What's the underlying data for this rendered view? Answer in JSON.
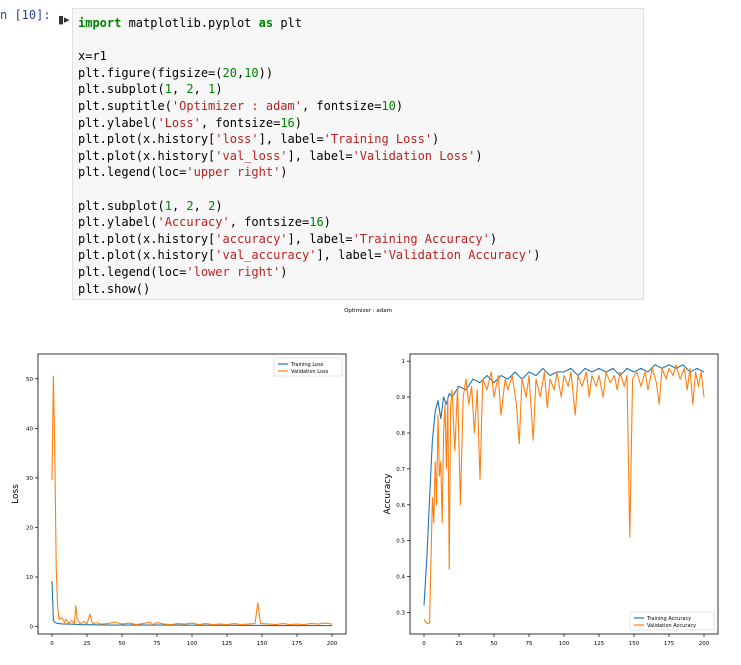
{
  "cell": {
    "prompt": "n [10]:",
    "code_lines": [
      [
        [
          "kw",
          "import"
        ],
        [
          "t",
          " matplotlib.pyplot "
        ],
        [
          "kw",
          "as"
        ],
        [
          "t",
          " plt"
        ]
      ],
      [],
      [
        [
          "t",
          "x=r1"
        ]
      ],
      [
        [
          "t",
          "plt.figure(figsize=("
        ],
        [
          "num",
          "20"
        ],
        [
          "t",
          ","
        ],
        [
          "num",
          "10"
        ],
        [
          "t",
          "))"
        ]
      ],
      [
        [
          "t",
          "plt.subplot("
        ],
        [
          "num",
          "1"
        ],
        [
          "t",
          ", "
        ],
        [
          "num",
          "2"
        ],
        [
          "t",
          ", "
        ],
        [
          "num",
          "1"
        ],
        [
          "t",
          ")"
        ]
      ],
      [
        [
          "t",
          "plt.suptitle("
        ],
        [
          "str",
          "'Optimizer : adam'"
        ],
        [
          "t",
          ", fontsize="
        ],
        [
          "num",
          "10"
        ],
        [
          "t",
          ")"
        ]
      ],
      [
        [
          "t",
          "plt.ylabel("
        ],
        [
          "str",
          "'Loss'"
        ],
        [
          "t",
          ", fontsize="
        ],
        [
          "num",
          "16"
        ],
        [
          "t",
          ")"
        ]
      ],
      [
        [
          "t",
          "plt.plot(x.history["
        ],
        [
          "str",
          "'loss'"
        ],
        [
          "t",
          "], label="
        ],
        [
          "str",
          "'Training Loss'"
        ],
        [
          "t",
          ")"
        ]
      ],
      [
        [
          "t",
          "plt.plot(x.history["
        ],
        [
          "str",
          "'val_loss'"
        ],
        [
          "t",
          "], label="
        ],
        [
          "str",
          "'Validation Loss'"
        ],
        [
          "t",
          ")"
        ]
      ],
      [
        [
          "t",
          "plt.legend(loc="
        ],
        [
          "str",
          "'upper right'"
        ],
        [
          "t",
          ")"
        ]
      ],
      [],
      [
        [
          "t",
          "plt.subplot("
        ],
        [
          "num",
          "1"
        ],
        [
          "t",
          ", "
        ],
        [
          "num",
          "2"
        ],
        [
          "t",
          ", "
        ],
        [
          "num",
          "2"
        ],
        [
          "t",
          ")"
        ]
      ],
      [
        [
          "t",
          "plt.ylabel("
        ],
        [
          "str",
          "'Accuracy'"
        ],
        [
          "t",
          ", fontsize="
        ],
        [
          "num",
          "16"
        ],
        [
          "t",
          ")"
        ]
      ],
      [
        [
          "t",
          "plt.plot(x.history["
        ],
        [
          "str",
          "'accuracy'"
        ],
        [
          "t",
          "], label="
        ],
        [
          "str",
          "'Training Accuracy'"
        ],
        [
          "t",
          ")"
        ]
      ],
      [
        [
          "t",
          "plt.plot(x.history["
        ],
        [
          "str",
          "'val_accuracy'"
        ],
        [
          "t",
          "], label="
        ],
        [
          "str",
          "'Validation Accuracy'"
        ],
        [
          "t",
          ")"
        ]
      ],
      [
        [
          "t",
          "plt.legend(loc="
        ],
        [
          "str",
          "'lower right'"
        ],
        [
          "t",
          ")"
        ]
      ],
      [
        [
          "t",
          "plt.show()"
        ]
      ]
    ]
  },
  "figure": {
    "suptitle": "Optimizer : adam"
  },
  "colors": {
    "training": "#1f77b4",
    "validation": "#ff7f0e"
  },
  "chart_data": [
    {
      "type": "line",
      "ylabel": "Loss",
      "xlabel": "",
      "xlim": [
        -10,
        210
      ],
      "ylim": [
        -1.5,
        55
      ],
      "xticks": [
        0,
        25,
        50,
        75,
        100,
        125,
        150,
        175,
        200
      ],
      "yticks": [
        0,
        10,
        20,
        30,
        40,
        50
      ],
      "legend_loc": "upper right",
      "series": [
        {
          "name": "Training Loss",
          "color": "#1f77b4",
          "points": [
            [
              0,
              9.2
            ],
            [
              1,
              1.2
            ],
            [
              2,
              0.9
            ],
            [
              3,
              0.7
            ],
            [
              5,
              0.6
            ],
            [
              8,
              0.5
            ],
            [
              12,
              0.5
            ],
            [
              20,
              0.4
            ],
            [
              40,
              0.3
            ],
            [
              80,
              0.3
            ],
            [
              120,
              0.25
            ],
            [
              160,
              0.2
            ],
            [
              200,
              0.2
            ]
          ]
        },
        {
          "name": "Validation Loss",
          "color": "#ff7f0e",
          "points": [
            [
              0,
              29.5
            ],
            [
              1,
              50.5
            ],
            [
              2,
              35
            ],
            [
              3,
              12
            ],
            [
              4,
              4
            ],
            [
              5,
              1.5
            ],
            [
              7,
              1.8
            ],
            [
              9,
              0.8
            ],
            [
              10,
              1.5
            ],
            [
              12,
              0.7
            ],
            [
              14,
              1.2
            ],
            [
              16,
              0.6
            ],
            [
              17,
              4.2
            ],
            [
              18,
              1.5
            ],
            [
              20,
              0.6
            ],
            [
              23,
              1.0
            ],
            [
              25,
              0.5
            ],
            [
              27,
              2.5
            ],
            [
              29,
              0.6
            ],
            [
              32,
              0.8
            ],
            [
              35,
              0.5
            ],
            [
              40,
              0.6
            ],
            [
              45,
              0.9
            ],
            [
              50,
              0.5
            ],
            [
              55,
              0.7
            ],
            [
              60,
              0.4
            ],
            [
              65,
              0.6
            ],
            [
              70,
              0.9
            ],
            [
              72,
              0.4
            ],
            [
              75,
              0.8
            ],
            [
              80,
              0.5
            ],
            [
              85,
              0.4
            ],
            [
              90,
              0.6
            ],
            [
              95,
              0.5
            ],
            [
              100,
              0.7
            ],
            [
              105,
              0.4
            ],
            [
              110,
              0.6
            ],
            [
              115,
              0.4
            ],
            [
              120,
              0.5
            ],
            [
              125,
              0.4
            ],
            [
              130,
              0.6
            ],
            [
              135,
              0.4
            ],
            [
              140,
              0.5
            ],
            [
              145,
              0.6
            ],
            [
              147,
              4.8
            ],
            [
              149,
              0.6
            ],
            [
              155,
              0.5
            ],
            [
              160,
              0.4
            ],
            [
              165,
              0.6
            ],
            [
              170,
              0.4
            ],
            [
              175,
              0.5
            ],
            [
              180,
              0.4
            ],
            [
              185,
              0.6
            ],
            [
              190,
              0.5
            ],
            [
              195,
              0.7
            ],
            [
              200,
              0.5
            ]
          ]
        }
      ]
    },
    {
      "type": "line",
      "ylabel": "Accuracy",
      "xlabel": "",
      "xlim": [
        -10,
        210
      ],
      "ylim": [
        0.24,
        1.02
      ],
      "xticks": [
        0,
        25,
        50,
        75,
        100,
        125,
        150,
        175,
        200
      ],
      "yticks": [
        0.3,
        0.4,
        0.5,
        0.6,
        0.7,
        0.8,
        0.9,
        1.0
      ],
      "legend_loc": "lower right",
      "series": [
        {
          "name": "Training Accuracy",
          "color": "#1f77b4",
          "points": [
            [
              0,
              0.32
            ],
            [
              2,
              0.45
            ],
            [
              4,
              0.62
            ],
            [
              6,
              0.78
            ],
            [
              8,
              0.86
            ],
            [
              10,
              0.89
            ],
            [
              12,
              0.84
            ],
            [
              14,
              0.9
            ],
            [
              16,
              0.88
            ],
            [
              18,
              0.91
            ],
            [
              20,
              0.9
            ],
            [
              25,
              0.93
            ],
            [
              30,
              0.92
            ],
            [
              35,
              0.95
            ],
            [
              40,
              0.94
            ],
            [
              45,
              0.96
            ],
            [
              50,
              0.94
            ],
            [
              55,
              0.96
            ],
            [
              60,
              0.95
            ],
            [
              65,
              0.97
            ],
            [
              70,
              0.95
            ],
            [
              75,
              0.97
            ],
            [
              80,
              0.96
            ],
            [
              85,
              0.98
            ],
            [
              90,
              0.96
            ],
            [
              95,
              0.97
            ],
            [
              100,
              0.97
            ],
            [
              105,
              0.98
            ],
            [
              110,
              0.96
            ],
            [
              115,
              0.98
            ],
            [
              120,
              0.97
            ],
            [
              125,
              0.98
            ],
            [
              130,
              0.97
            ],
            [
              135,
              0.98
            ],
            [
              140,
              0.96
            ],
            [
              145,
              0.98
            ],
            [
              150,
              0.97
            ],
            [
              155,
              0.98
            ],
            [
              160,
              0.97
            ],
            [
              165,
              0.99
            ],
            [
              170,
              0.98
            ],
            [
              175,
              0.99
            ],
            [
              180,
              0.98
            ],
            [
              185,
              0.99
            ],
            [
              190,
              0.97
            ],
            [
              195,
              0.98
            ],
            [
              200,
              0.97
            ]
          ]
        },
        {
          "name": "Validation Accuracy",
          "color": "#ff7f0e",
          "points": [
            [
              0,
              0.28
            ],
            [
              2,
              0.27
            ],
            [
              4,
              0.27
            ],
            [
              5,
              0.45
            ],
            [
              6,
              0.62
            ],
            [
              7,
              0.55
            ],
            [
              8,
              0.72
            ],
            [
              9,
              0.6
            ],
            [
              10,
              0.85
            ],
            [
              11,
              0.68
            ],
            [
              12,
              0.72
            ],
            [
              13,
              0.55
            ],
            [
              14,
              0.8
            ],
            [
              15,
              0.88
            ],
            [
              16,
              0.7
            ],
            [
              17,
              0.9
            ],
            [
              18,
              0.42
            ],
            [
              19,
              0.87
            ],
            [
              20,
              0.92
            ],
            [
              22,
              0.75
            ],
            [
              24,
              0.93
            ],
            [
              26,
              0.6
            ],
            [
              28,
              0.9
            ],
            [
              30,
              0.95
            ],
            [
              32,
              0.88
            ],
            [
              34,
              0.93
            ],
            [
              36,
              0.8
            ],
            [
              38,
              0.92
            ],
            [
              40,
              0.67
            ],
            [
              42,
              0.95
            ],
            [
              45,
              0.92
            ],
            [
              48,
              0.97
            ],
            [
              50,
              0.9
            ],
            [
              53,
              0.96
            ],
            [
              55,
              0.85
            ],
            [
              58,
              0.95
            ],
            [
              60,
              0.92
            ],
            [
              63,
              0.96
            ],
            [
              66,
              0.88
            ],
            [
              68,
              0.77
            ],
            [
              70,
              0.95
            ],
            [
              73,
              0.9
            ],
            [
              75,
              0.96
            ],
            [
              78,
              0.78
            ],
            [
              80,
              0.95
            ],
            [
              83,
              0.9
            ],
            [
              86,
              0.97
            ],
            [
              88,
              0.87
            ],
            [
              90,
              0.95
            ],
            [
              93,
              0.92
            ],
            [
              95,
              0.97
            ],
            [
              98,
              0.9
            ],
            [
              100,
              0.96
            ],
            [
              103,
              0.93
            ],
            [
              105,
              0.97
            ],
            [
              108,
              0.85
            ],
            [
              110,
              0.96
            ],
            [
              113,
              0.93
            ],
            [
              116,
              0.97
            ],
            [
              118,
              0.9
            ],
            [
              120,
              0.96
            ],
            [
              123,
              0.93
            ],
            [
              125,
              0.96
            ],
            [
              128,
              0.9
            ],
            [
              130,
              0.97
            ],
            [
              133,
              0.94
            ],
            [
              136,
              0.96
            ],
            [
              138,
              0.92
            ],
            [
              140,
              0.97
            ],
            [
              143,
              0.93
            ],
            [
              145,
              0.96
            ],
            [
              147,
              0.51
            ],
            [
              149,
              0.95
            ],
            [
              152,
              0.97
            ],
            [
              155,
              0.93
            ],
            [
              158,
              0.97
            ],
            [
              160,
              0.92
            ],
            [
              163,
              0.98
            ],
            [
              166,
              0.94
            ],
            [
              168,
              0.88
            ],
            [
              170,
              0.98
            ],
            [
              173,
              0.95
            ],
            [
              175,
              0.98
            ],
            [
              178,
              0.96
            ],
            [
              180,
              0.99
            ],
            [
              183,
              0.95
            ],
            [
              186,
              0.98
            ],
            [
              188,
              0.92
            ],
            [
              190,
              0.98
            ],
            [
              192,
              0.88
            ],
            [
              194,
              0.97
            ],
            [
              196,
              0.93
            ],
            [
              198,
              0.97
            ],
            [
              200,
              0.9
            ]
          ]
        }
      ]
    }
  ]
}
